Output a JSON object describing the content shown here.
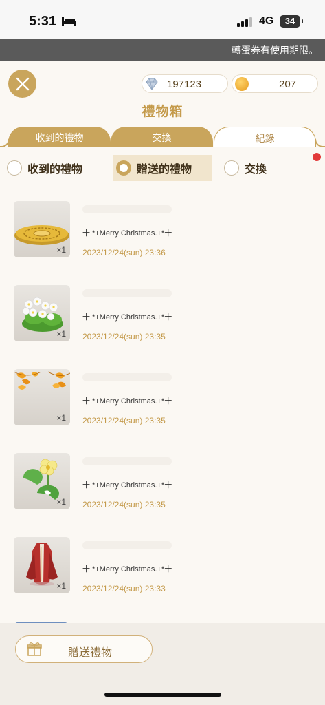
{
  "status": {
    "time": "5:31",
    "network": "4G",
    "battery": "34"
  },
  "notice": "轉蛋券有使用期限。",
  "header": {
    "title": "禮物箱",
    "diamonds": "197123",
    "coins": "207"
  },
  "tabs": [
    {
      "label": "收到的禮物"
    },
    {
      "label": "交換"
    },
    {
      "label": "紀錄"
    }
  ],
  "filters": [
    {
      "label": "收到的禮物"
    },
    {
      "label": "贈送的禮物"
    },
    {
      "label": "交換"
    }
  ],
  "items": [
    {
      "qty": "×1",
      "message": "十.*+Merry Christmas.+*十",
      "date": "2023/12/24(sun) 23:36",
      "icon": "golden-rug-icon"
    },
    {
      "qty": "×1",
      "message": "十.*+Merry Christmas.+*十",
      "date": "2023/12/24(sun) 23:35",
      "icon": "white-flower-bush-icon"
    },
    {
      "qty": "×1",
      "message": "十.*+Merry Christmas.+*十",
      "date": "2023/12/24(sun) 23:35",
      "icon": "autumn-leaves-icon"
    },
    {
      "qty": "×1",
      "message": "十.*+Merry Christmas.+*十",
      "date": "2023/12/24(sun) 23:35",
      "icon": "yellow-flower-lilypad-icon"
    },
    {
      "qty": "×1",
      "message": "十.*+Merry Christmas.+*十",
      "date": "2023/12/24(sun) 23:33",
      "icon": "red-robe-icon"
    }
  ],
  "footer": {
    "send_label": "贈送禮物"
  },
  "colors": {
    "gold": "#c9a55c",
    "date": "#c49a4a",
    "notice_bg": "#5a5a5a",
    "red_dot": "#e23a3a"
  }
}
